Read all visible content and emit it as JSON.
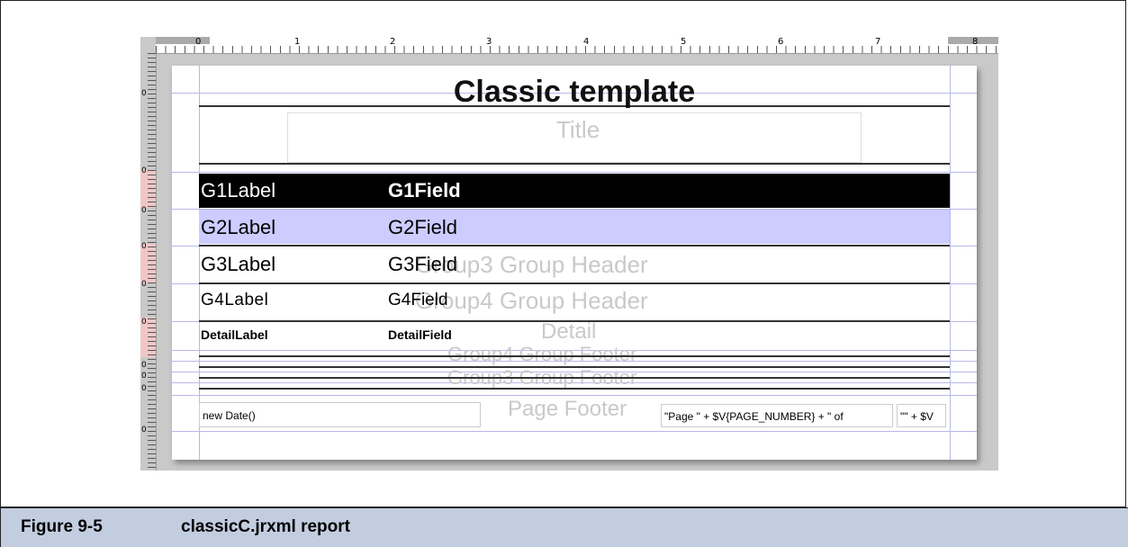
{
  "ruler": {
    "labels": [
      "0",
      "1",
      "2",
      "3",
      "4",
      "5",
      "6",
      "7",
      "8"
    ]
  },
  "report": {
    "title_band": "Title",
    "title_text": "Classic template",
    "g1": {
      "label": "G1Label",
      "field": "G1Field"
    },
    "g2": {
      "label": "G2Label",
      "field": "G2Field"
    },
    "g3": {
      "label": "G3Label",
      "field": "G3Field",
      "band": "Group3 Group Header"
    },
    "g4": {
      "label": "G4Label",
      "field": "G4Field",
      "band": "Group4 Group Header"
    },
    "detail": {
      "label": "DetailLabel",
      "field": "DetailField",
      "band": "Detail"
    },
    "group_footers": [
      "Group4 Group Footer",
      "Group3 Group Footer"
    ],
    "page_footer_band": "Page Footer",
    "footer_date": "new Date()",
    "footer_page": "\"Page \" + $V{PAGE_NUMBER} + \" of",
    "footer_page_total": "\"\" + $V"
  },
  "colors": {
    "g1_background": "#000000",
    "g2_background": "#ccccff",
    "caption_background": "#c3cde0"
  },
  "caption": {
    "number": "Figure 9-5",
    "text": "classicC.jrxml report"
  }
}
